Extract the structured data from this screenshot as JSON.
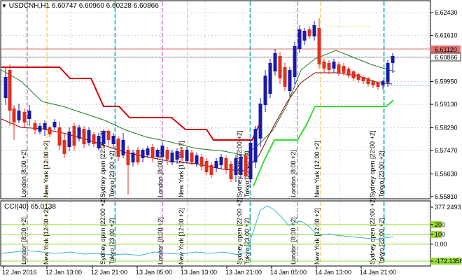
{
  "header": {
    "menu_icon": "triangle-down-icon",
    "symbol": "USDCNH,H1",
    "ohlc": "6.60747 6.60960 6.60228 6.60866"
  },
  "cci": {
    "label": "CCI(40) 65.0138"
  },
  "chart_data": {
    "type": "candlestick",
    "title": "USDCNH,H1 6.60747 6.60960 6.60228 6.60866",
    "price_axis": [
      "6.62430",
      "6.61610",
      "6.60866",
      "6.59950",
      "6.59130",
      "6.58290",
      "6.57470",
      "6.56630",
      "6.55810"
    ],
    "ylim": [
      6.5581,
      6.6262
    ],
    "bid_price": "6.60866",
    "ask_price": "6.61120",
    "cci_axis": [
      "377.2493",
      "200",
      "100",
      "0.00",
      "-172.1356"
    ],
    "time_axis": [
      "12 Jan 2016",
      "12 Jan 13:00",
      "12 Jan 21:00",
      "13 Jan 05:00",
      "13 Jan 13:00",
      "13 Jan 21:00",
      "14 Jan 05:00",
      "14 Jan 13:00",
      "14 Jan 21:00"
    ],
    "session_labels": [
      "London [8:00 +2]",
      "New York [12:00 +2]",
      "Sydney open [22:00 +2]",
      "Tokyo [23:00 +2]",
      "London [8:00 +2]",
      "New York [12:00 +2]",
      "Sydney open [22:00 +2]",
      "Tokyo [23:00 +2]",
      "London [8:00 +2]",
      "New York [12:00 +2]",
      "Sydney open [22:00 +2]",
      "Tokyo [23:00 +2]"
    ],
    "colors": {
      "bull": "#1a1aa8",
      "bear": "#e0301e",
      "red_line": "#d40000",
      "green_line": "#33dd33",
      "dark_ma": "#1f7a1f",
      "thin_red_ma": "#8b0000",
      "cci": "#3bb3c3",
      "level": "#99dd33",
      "london": "#c040c0",
      "newyork": "#e6c040",
      "sydney": "#40c0c0",
      "grid": "#b0b0c8"
    }
  }
}
